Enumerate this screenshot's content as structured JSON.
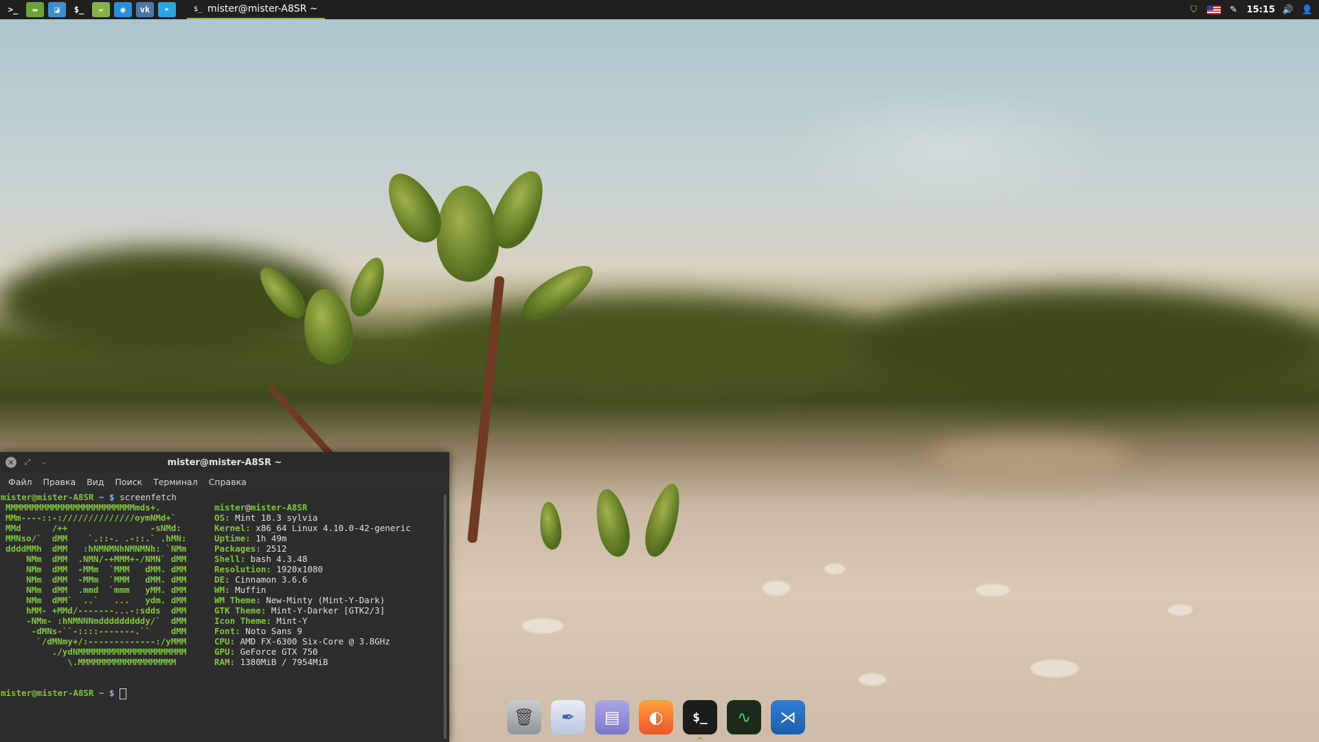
{
  "panel": {
    "launchers": [
      {
        "name": "terminal-launcher",
        "glyph": ">_",
        "bg": "#1f1f1f",
        "fg": "#ffffff"
      },
      {
        "name": "files-launcher",
        "glyph": "▬",
        "bg": "#6ea33a",
        "fg": "#d9f0b0"
      },
      {
        "name": "software-launcher",
        "glyph": "◪",
        "bg": "#3f8fd0",
        "fg": "#ffffff"
      },
      {
        "name": "terminal2-launcher",
        "glyph": "$_",
        "bg": "#1f1f1f",
        "fg": "#ffffff"
      },
      {
        "name": "folder-launcher",
        "glyph": "▰",
        "bg": "#87b04a",
        "fg": "#c7e79a"
      },
      {
        "name": "skype-launcher",
        "glyph": "◉",
        "bg": "#2a8fd8",
        "fg": "#ffffff"
      },
      {
        "name": "vk-launcher",
        "glyph": "vk",
        "bg": "#4a76a8",
        "fg": "#ffffff"
      },
      {
        "name": "telegram-launcher",
        "glyph": "➤",
        "bg": "#2ca5e0",
        "fg": "#ffffff"
      }
    ],
    "active_window": "mister@mister-A8SR ~",
    "clock": "15:15"
  },
  "terminal": {
    "title": "mister@mister-A8SR ~",
    "menu": [
      "Файл",
      "Правка",
      "Вид",
      "Поиск",
      "Терминал",
      "Справка"
    ],
    "prompt_user": "mister@mister-A8SR",
    "prompt_suffix": " ~ $ ",
    "command": "screenfetch",
    "logo": [
      "MMMMMMMMMMMMMMMMMMMMMMMMMmds+.",
      "MMm----::-://////////////oymNMd+`",
      "MMd      /++                -sNMd:",
      "MMNso/`  dMM    `.::-. .-::.` .hMN:",
      "ddddMMh  dMM   :hNMNMNhNMNMNh: `NMm",
      "    NMm  dMM  .NMN/-+MMM+-/NMN` dMM",
      "    NMm  dMM  -MMm  `MMM   dMM. dMM",
      "    NMm  dMM  -MMm  `MMM   dMM. dMM",
      "    NMm  dMM  .mmd  `mmm   yMM. dMM",
      "    NMm  dMM`  ..`   ...   ydm. dMM",
      "    hMM- +MMd/-------...-:sdds  dMM",
      "    -NMm- :hNMNNNmdddddddddy/`  dMM",
      "     -dMNs-``-::::-------.``    dMM",
      "      `/dMNmy+/:-------------:/yMMM",
      "         ./ydNMMMMMMMMMMMMMMMMMMMMM",
      "            \\.MMMMMMMMMMMMMMMMMMM"
    ],
    "header_user": "mister",
    "header_at": "@",
    "header_host": "mister-A8SR",
    "info": [
      {
        "k": "OS:",
        "v": " Mint 18.3 sylvia"
      },
      {
        "k": "Kernel:",
        "v": " x86_64 Linux 4.10.0-42-generic"
      },
      {
        "k": "Uptime:",
        "v": " 1h 49m"
      },
      {
        "k": "Packages:",
        "v": " 2512"
      },
      {
        "k": "Shell:",
        "v": " bash 4.3.48"
      },
      {
        "k": "Resolution:",
        "v": " 1920x1080"
      },
      {
        "k": "DE:",
        "v": " Cinnamon 3.6.6"
      },
      {
        "k": "WM:",
        "v": " Muffin"
      },
      {
        "k": "WM Theme:",
        "v": " New-Minty (Mint-Y-Dark)"
      },
      {
        "k": "GTK Theme:",
        "v": " Mint-Y-Darker [GTK2/3]"
      },
      {
        "k": "Icon Theme:",
        "v": " Mint-Y"
      },
      {
        "k": "Font:",
        "v": " Noto Sans 9"
      },
      {
        "k": "CPU:",
        "v": " AMD FX-6300 Six-Core @ 3.8GHz"
      },
      {
        "k": "GPU:",
        "v": " GeForce GTX 750"
      },
      {
        "k": "RAM:",
        "v": " 1380MiB / 7954MiB"
      }
    ]
  },
  "dock": [
    {
      "name": "trash-icon",
      "glyph": "🗑",
      "bg": "linear-gradient(#c9cdd0,#8f969b)",
      "fg": "#444"
    },
    {
      "name": "feather-icon",
      "glyph": "✒",
      "bg": "linear-gradient(#e9eef7,#b9c6de)",
      "fg": "#3b5fa8"
    },
    {
      "name": "text-editor-icon",
      "glyph": "▤",
      "bg": "linear-gradient(#a9a6e6,#7c78c9)",
      "fg": "#ffffff"
    },
    {
      "name": "firefox-icon",
      "glyph": "◐",
      "bg": "linear-gradient(#ffa23a,#e8562a)",
      "fg": "#ffffff"
    },
    {
      "name": "terminal-icon",
      "glyph": "$_",
      "bg": "#1c1c1c",
      "fg": "#ffffff"
    },
    {
      "name": "system-monitor-icon",
      "glyph": "∿",
      "bg": "#1c2a1c",
      "fg": "#3fd36a"
    },
    {
      "name": "vscode-icon",
      "glyph": "⋊",
      "bg": "linear-gradient(#2f7fd4,#1d5fa8)",
      "fg": "#ffffff"
    }
  ]
}
